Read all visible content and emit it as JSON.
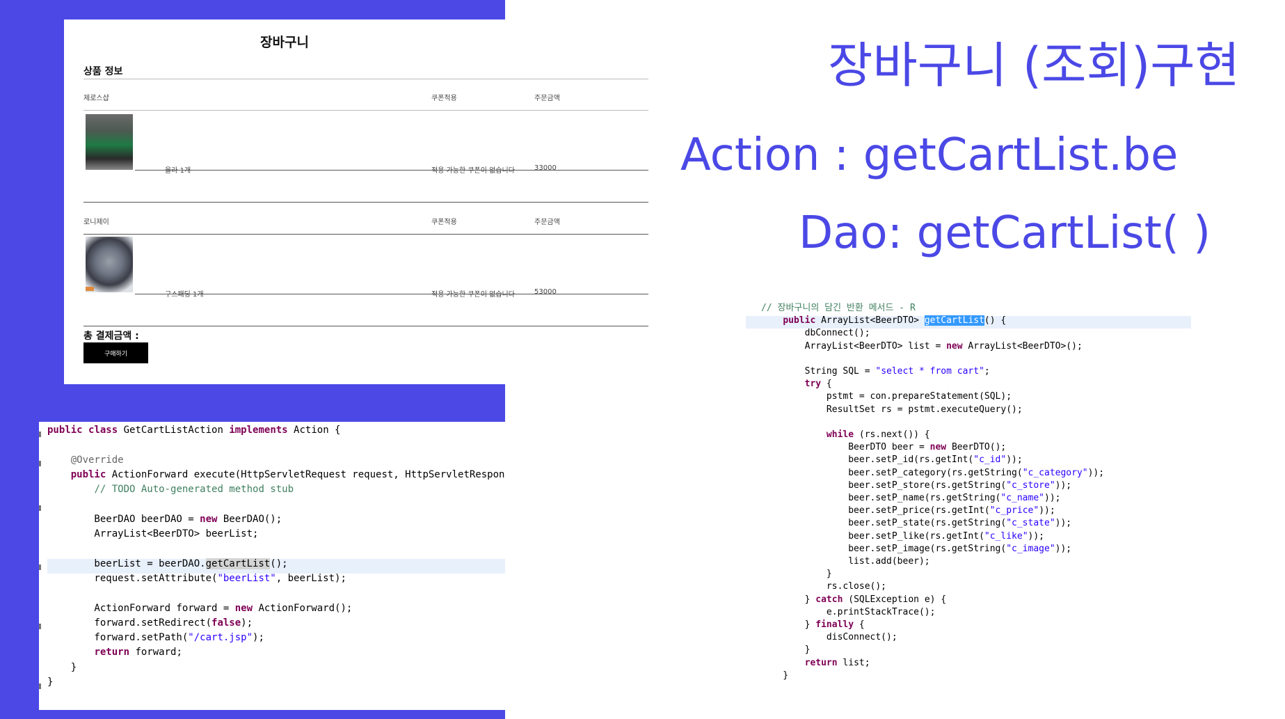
{
  "slide": {
    "title": "장바구니 (조회)구현",
    "action_line": "Action : getCartList.be",
    "dao_line": "Dao: getCartList( )"
  },
  "cart_page": {
    "title": "장바구니",
    "section": "상품 정보",
    "groups": [
      {
        "store": "제로스샵",
        "coupon_header": "쿠폰적용",
        "amount_header": "주문금액",
        "item": "울라 1개",
        "coupon_text": "적용 가능한 쿠폰이 없습니다",
        "amount": "33000"
      },
      {
        "store": "로니제이",
        "coupon_header": "쿠폰적용",
        "amount_header": "주문금액",
        "item": "구스패딩 1개",
        "coupon_text": "적용 가능한 쿠폰이 없습니다",
        "amount": "53000"
      }
    ],
    "total_label": "총 결제금액 :",
    "buy_button": "구매하기"
  },
  "action_code": {
    "lines": [
      "public class GetCartListAction implements Action {",
      "",
      "    @Override",
      "    public ActionForward execute(HttpServletRequest request, HttpServletResponse response) throws Exception {",
      "        // TODO Auto-generated method stub",
      "",
      "        BeerDAO beerDAO = new BeerDAO();",
      "        ArrayList<BeerDTO> beerList;",
      "",
      "        beerList = beerDAO.getCartList();",
      "        request.setAttribute(\"beerList\", beerList);",
      "",
      "        ActionForward forward = new ActionForward();",
      "        forward.setRedirect(false);",
      "        forward.setPath(\"/cart.jsp\");",
      "        return forward;",
      "    }",
      "}"
    ]
  },
  "dao_code": {
    "lines": [
      "// 장바구니의 담긴 반환 메서드 - R",
      "    public ArrayList<BeerDTO> getCartList() {",
      "        dbConnect();",
      "        ArrayList<BeerDTO> list = new ArrayList<BeerDTO>();",
      "",
      "        String SQL = \"select * from cart\";",
      "        try {",
      "            pstmt = con.prepareStatement(SQL);",
      "            ResultSet rs = pstmt.executeQuery();",
      "",
      "            while (rs.next()) {",
      "                BeerDTO beer = new BeerDTO();",
      "                beer.setP_id(rs.getInt(\"c_id\"));",
      "                beer.setP_category(rs.getString(\"c_category\"));",
      "                beer.setP_store(rs.getString(\"c_store\"));",
      "                beer.setP_name(rs.getString(\"c_name\"));",
      "                beer.setP_price(rs.getInt(\"c_price\"));",
      "                beer.setP_state(rs.getString(\"c_state\"));",
      "                beer.setP_like(rs.getInt(\"c_like\"));",
      "                beer.setP_image(rs.getString(\"c_image\"));",
      "                list.add(beer);",
      "            }",
      "            rs.close();",
      "        } catch (SQLException e) {",
      "            e.printStackTrace();",
      "        } finally {",
      "            disConnect();",
      "        }",
      "        return list;",
      "    }"
    ]
  }
}
